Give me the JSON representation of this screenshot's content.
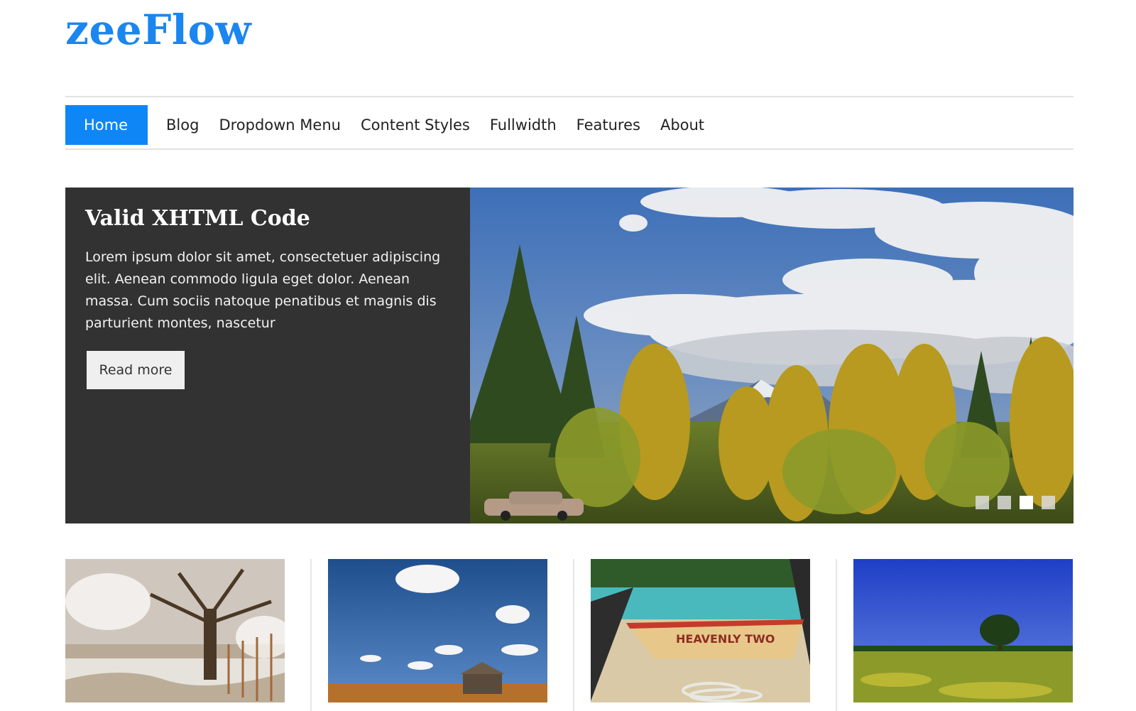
{
  "site": {
    "logo": "zeeFlow",
    "brand_color": "#1a86f0"
  },
  "nav": {
    "items": [
      {
        "label": "Home",
        "active": true
      },
      {
        "label": "Blog"
      },
      {
        "label": "Dropdown Menu"
      },
      {
        "label": "Content Styles"
      },
      {
        "label": "Fullwidth"
      },
      {
        "label": "Features"
      },
      {
        "label": "About"
      }
    ],
    "active_color": "#0f86f5"
  },
  "slider": {
    "title": "Valid XHTML Code",
    "text": "Lorem ipsum dolor sit amet, consectetuer adipiscing elit. Aenean commodo ligula eget dolor. Aenean massa. Cum sociis natoque penatibus et magnis dis parturient montes, nascetur",
    "button_label": "Read more",
    "pager": {
      "count": 4,
      "active_index": 2
    }
  },
  "thumbnails": [
    {
      "icon": "winter-tree-image"
    },
    {
      "icon": "barn-field-image"
    },
    {
      "icon": "beach-boat-image"
    },
    {
      "icon": "tree-meadow-image"
    }
  ]
}
